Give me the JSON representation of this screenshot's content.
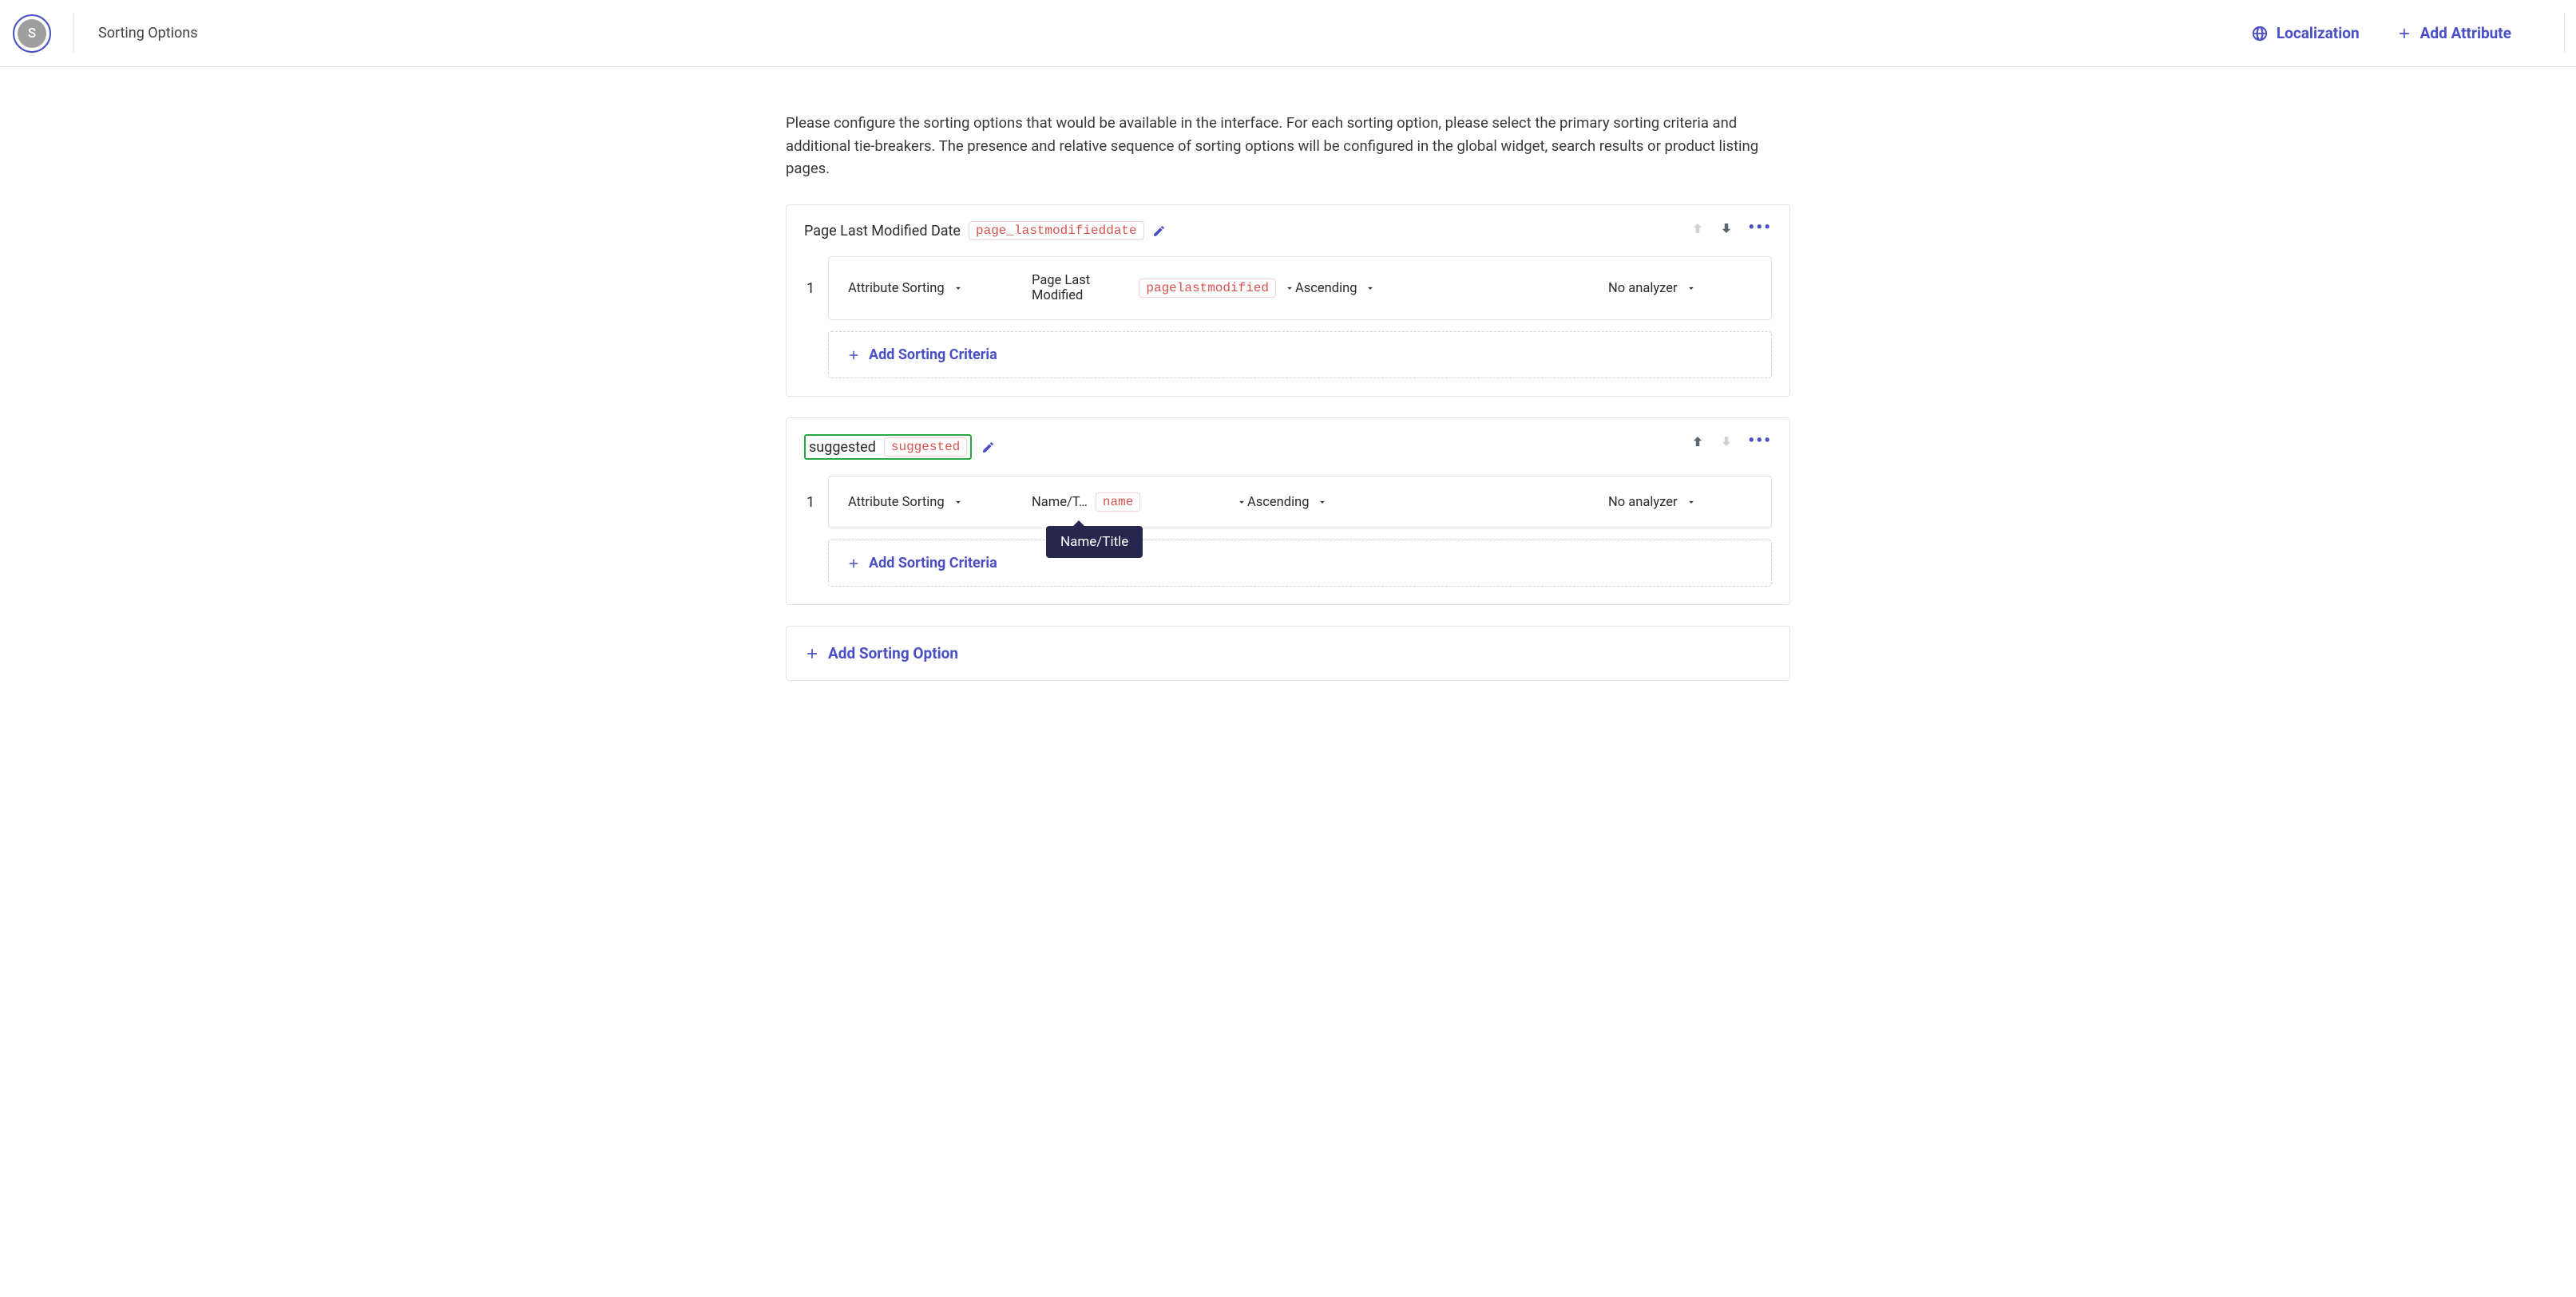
{
  "avatar_letter": "S",
  "page_title": "Sorting Options",
  "actions": {
    "localization": "Localization",
    "add_attribute": "Add Attribute"
  },
  "intro": "Please configure the sorting options that would be available in the interface. For each sorting option, please select the primary sorting criteria and additional tie-breakers. The presence and relative sequence of sorting options will be configured in the global widget, search results or product listing pages.",
  "options": [
    {
      "title": "Page Last Modified Date",
      "code": "page_lastmodifieddate",
      "highlighted": false,
      "up_enabled": false,
      "down_enabled": true,
      "criteria": [
        {
          "index": "1",
          "sorting_type": "Attribute Sorting",
          "attribute_label": "Page Last Modified",
          "attribute_code": "pagelastmodified",
          "direction": "Ascending",
          "analyzer": "No analyzer",
          "tooltip": null
        }
      ]
    },
    {
      "title": "suggested",
      "code": "suggested",
      "highlighted": true,
      "up_enabled": true,
      "down_enabled": false,
      "criteria": [
        {
          "index": "1",
          "sorting_type": "Attribute Sorting",
          "attribute_label": "Name/T…",
          "attribute_code": "name",
          "direction": "Ascending",
          "analyzer": "No analyzer",
          "tooltip": "Name/Title"
        }
      ]
    }
  ],
  "labels": {
    "add_sorting_criteria": "Add Sorting Criteria",
    "add_sorting_option": "Add Sorting Option"
  }
}
